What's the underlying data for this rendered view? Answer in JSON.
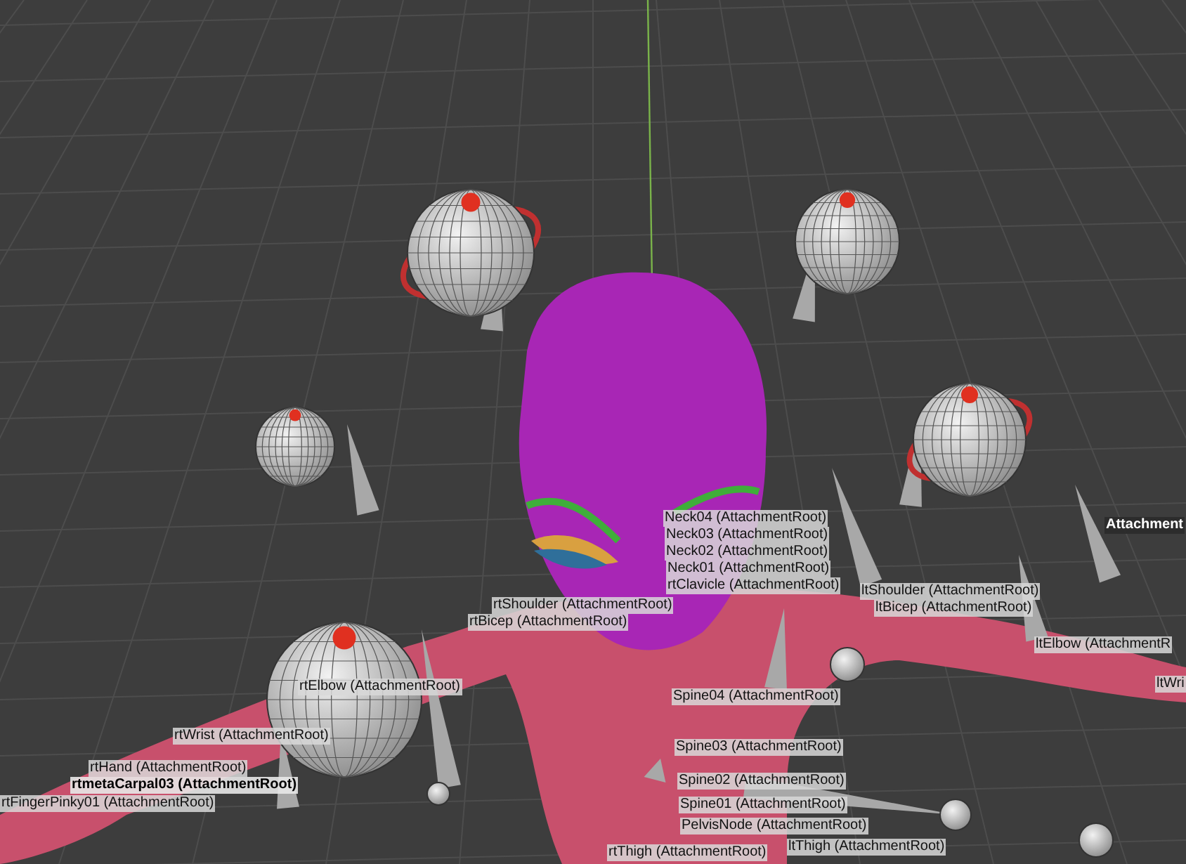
{
  "viewport": {
    "labels": [
      {
        "text": "Neck04 (AttachmentRoot)",
        "kind": "bone"
      },
      {
        "text": "Neck03 (AttachmentRoot)",
        "kind": "bone"
      },
      {
        "text": "Neck02 (AttachmentRoot)",
        "kind": "bone"
      },
      {
        "text": "Neck01 (AttachmentRoot)",
        "kind": "bone"
      },
      {
        "text": "rtClavicle (AttachmentRoot)",
        "kind": "bone"
      },
      {
        "text": "rtShoulder (AttachmentRoot)",
        "kind": "bone"
      },
      {
        "text": "rtBicep (AttachmentRoot)",
        "kind": "bone"
      },
      {
        "text": "ltShoulder (AttachmentRoot)",
        "kind": "bone"
      },
      {
        "text": "ltBicep (AttachmentRoot)",
        "kind": "bone"
      },
      {
        "text": "Attachment",
        "kind": "active"
      },
      {
        "text": "ltElbow (AttachmentR",
        "kind": "bone"
      },
      {
        "text": "ltWri",
        "kind": "bone"
      },
      {
        "text": "rtElbow (AttachmentRoot)",
        "kind": "bone"
      },
      {
        "text": "rtWrist (AttachmentRoot)",
        "kind": "bone"
      },
      {
        "text": "rtHand (AttachmentRoot)",
        "kind": "bone"
      },
      {
        "text": "rtmetaCarpal03 (AttachmentRoot)",
        "kind": "selected"
      },
      {
        "text": "rtFingerPinky01 (AttachmentRoot)",
        "kind": "bone"
      },
      {
        "text": "Spine04 (AttachmentRoot)",
        "kind": "bone"
      },
      {
        "text": "Spine03 (AttachmentRoot)",
        "kind": "bone"
      },
      {
        "text": "Spine02 (AttachmentRoot)",
        "kind": "bone"
      },
      {
        "text": "Spine01 (AttachmentRoot)",
        "kind": "bone"
      },
      {
        "text": "PelvisNode (AttachmentRoot)",
        "kind": "bone"
      },
      {
        "text": "ltThigh (AttachmentRoot)",
        "kind": "bone"
      },
      {
        "text": "rtThigh (AttachmentRoot)",
        "kind": "bone"
      }
    ]
  }
}
